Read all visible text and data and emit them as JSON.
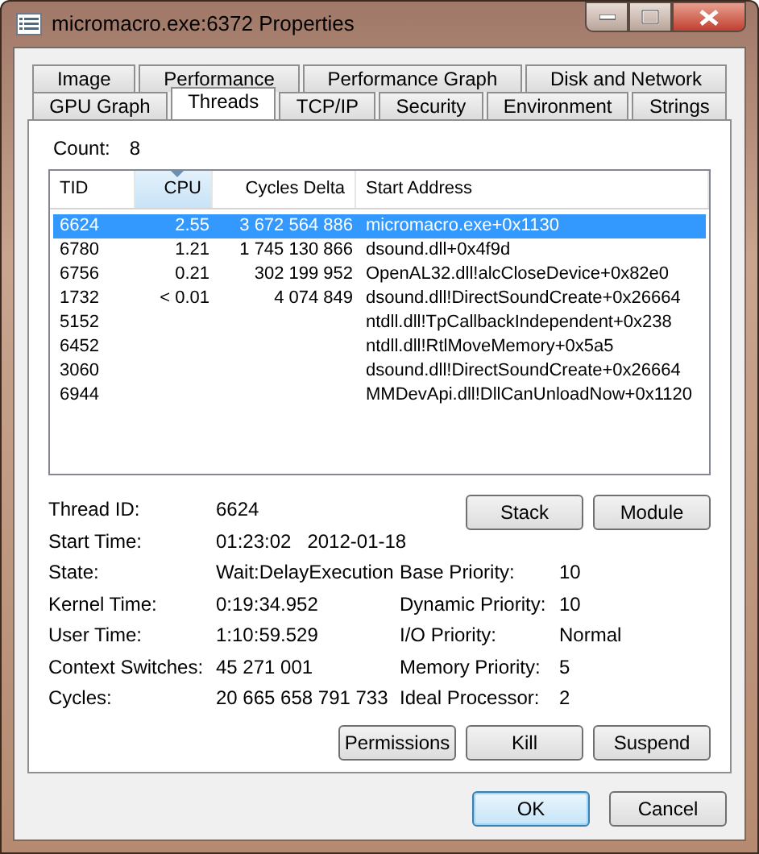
{
  "window": {
    "title": "micromacro.exe:6372 Properties"
  },
  "tab_rows": [
    {
      "tabs": [
        {
          "label": "Image",
          "selected": false
        },
        {
          "label": "Performance",
          "selected": false
        },
        {
          "label": "Performance Graph",
          "selected": false
        },
        {
          "label": "Disk and Network",
          "selected": false
        }
      ]
    },
    {
      "tabs": [
        {
          "label": "GPU Graph",
          "selected": false
        },
        {
          "label": "Threads",
          "selected": true
        },
        {
          "label": "TCP/IP",
          "selected": false
        },
        {
          "label": "Security",
          "selected": false
        },
        {
          "label": "Environment",
          "selected": false
        },
        {
          "label": "Strings",
          "selected": false
        }
      ]
    }
  ],
  "count": {
    "label": "Count:",
    "value": "8"
  },
  "threads_table": {
    "columns": [
      {
        "label": "TID",
        "sorted": false
      },
      {
        "label": "CPU",
        "sorted": true
      },
      {
        "label": "Cycles Delta",
        "sorted": false
      },
      {
        "label": "Start Address",
        "sorted": false
      }
    ],
    "rows": [
      {
        "cells": [
          "6624",
          "2.55",
          "3 672 564 886",
          "micromacro.exe+0x1130"
        ],
        "selected": true
      },
      {
        "cells": [
          "6780",
          "1.21",
          "1 745 130 866",
          "dsound.dll+0x4f9d"
        ],
        "selected": false
      },
      {
        "cells": [
          "6756",
          "0.21",
          "302 199 952",
          "OpenAL32.dll!alcCloseDevice+0x82e0"
        ],
        "selected": false
      },
      {
        "cells": [
          "1732",
          "< 0.01",
          "4 074 849",
          "dsound.dll!DirectSoundCreate+0x26664"
        ],
        "selected": false
      },
      {
        "cells": [
          "5152",
          "",
          "",
          "ntdll.dll!TpCallbackIndependent+0x238"
        ],
        "selected": false
      },
      {
        "cells": [
          "6452",
          "",
          "",
          "ntdll.dll!RtlMoveMemory+0x5a5"
        ],
        "selected": false
      },
      {
        "cells": [
          "3060",
          "",
          "",
          "dsound.dll!DirectSoundCreate+0x26664"
        ],
        "selected": false
      },
      {
        "cells": [
          "6944",
          "",
          "",
          "MMDevApi.dll!DllCanUnloadNow+0x1120"
        ],
        "selected": false
      }
    ]
  },
  "details_left": [
    {
      "label": "Thread ID:",
      "value": "6624"
    },
    {
      "label": "Start Time:",
      "value": "01:23:02   2012-01-18"
    },
    {
      "label": "State:",
      "value": "Wait:DelayExecution"
    },
    {
      "label": "Kernel Time:",
      "value": "0:19:34.952"
    },
    {
      "label": "User Time:",
      "value": "1:10:59.529"
    },
    {
      "label": "Context Switches:",
      "value": "45 271 001"
    },
    {
      "label": "Cycles:",
      "value": "20 665 658 791 733"
    }
  ],
  "details_right": [
    {
      "label": "Base Priority:",
      "value": "10"
    },
    {
      "label": "Dynamic Priority:",
      "value": "10"
    },
    {
      "label": "I/O Priority:",
      "value": "Normal"
    },
    {
      "label": "Memory Priority:",
      "value": "5"
    },
    {
      "label": "Ideal Processor:",
      "value": "2"
    }
  ],
  "thread_buttons": [
    "Stack",
    "Module"
  ],
  "action_buttons": [
    "Permissions",
    "Kill",
    "Suspend"
  ],
  "dialog_buttons": [
    {
      "label": "OK",
      "default": true
    },
    {
      "label": "Cancel",
      "default": false
    }
  ]
}
